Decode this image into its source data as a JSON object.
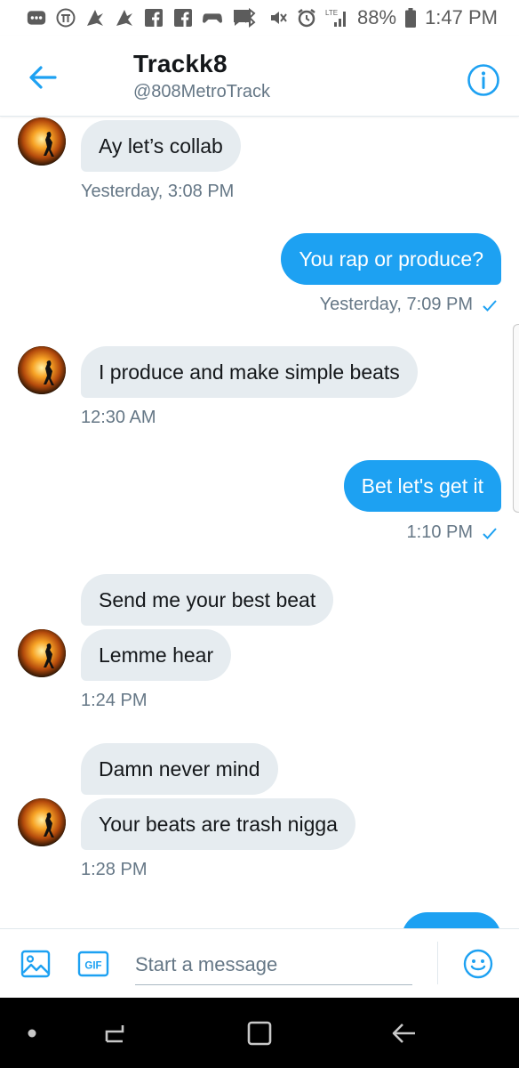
{
  "status_bar": {
    "battery_percent": "88%",
    "time": "1:47 PM",
    "network_label": "LTE"
  },
  "header": {
    "name": "Trackk8",
    "handle": "@808MetroTrack"
  },
  "messages": [
    {
      "direction": "in",
      "text": "Ay let’s collab",
      "timestamp": "Yesterday, 3:08 PM"
    },
    {
      "direction": "out",
      "text": "You rap or produce?",
      "timestamp": "Yesterday, 7:09 PM"
    },
    {
      "direction": "in",
      "text": "I produce and make simple beats",
      "timestamp": "12:30 AM"
    },
    {
      "direction": "out",
      "text": "Bet let's get it",
      "timestamp": "1:10 PM"
    },
    {
      "direction": "in",
      "text": "Send me your best beat",
      "timestamp": ""
    },
    {
      "direction": "in",
      "text": "Lemme hear",
      "timestamp": "1:24 PM"
    },
    {
      "direction": "in",
      "text": "Damn never mind",
      "timestamp": ""
    },
    {
      "direction": "in",
      "text": "Your beats are trash nigga",
      "timestamp": "1:28 PM"
    }
  ],
  "composer": {
    "placeholder": "Start a message",
    "gif_label": "GIF"
  },
  "colors": {
    "accent": "#1da1f2",
    "incoming_bubble": "#e6ecf0",
    "secondary_text": "#657786"
  }
}
